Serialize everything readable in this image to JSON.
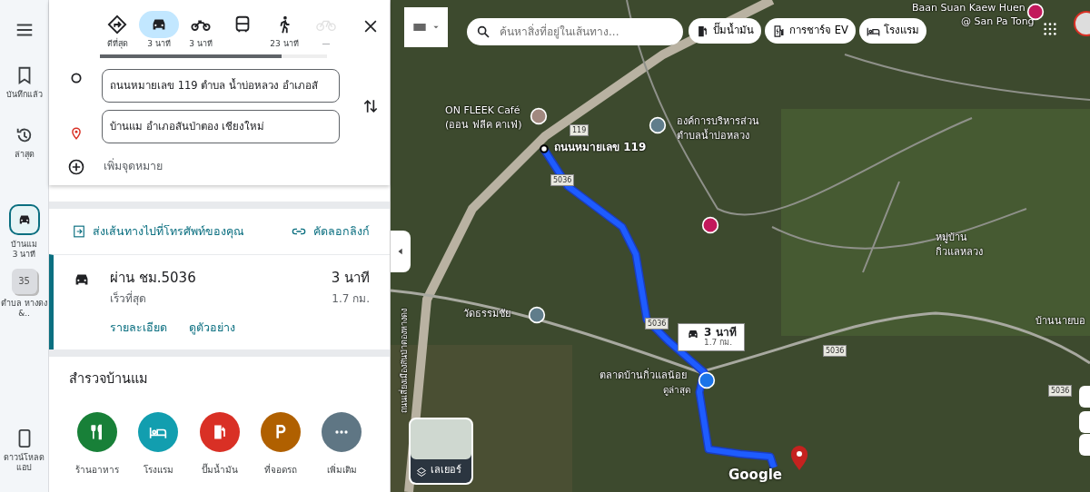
{
  "rail": [
    {
      "kind": "menu"
    },
    {
      "kind": "saved",
      "label": "บันทึกแล้ว"
    },
    {
      "kind": "recent",
      "label": "ล่าสุด"
    },
    {
      "kind": "trip",
      "label": "บ้านแม",
      "sub": "3 นาที",
      "selected": true
    },
    {
      "kind": "place",
      "badge": "35",
      "label": "ตำบล หางดง &..",
      "selected": false
    },
    {
      "kind": "download",
      "label": "ดาวน์โหลด แอป"
    }
  ],
  "modes": [
    {
      "kind": "best",
      "label": "ดีที่สุด",
      "selected": false,
      "disabled": false
    },
    {
      "kind": "car",
      "label": "3 นาที",
      "selected": true,
      "disabled": false
    },
    {
      "kind": "moto",
      "label": "3 นาที",
      "selected": false,
      "disabled": false
    },
    {
      "kind": "transit",
      "selected": false,
      "disabled": false
    },
    {
      "kind": "walk",
      "label": "23 นาที",
      "selected": false,
      "disabled": false
    },
    {
      "kind": "bike",
      "label": "—",
      "selected": false,
      "disabled": true
    }
  ],
  "origin": "ถนนหมายเลข 119 ตำบล น้ำบ่อหลวง อำเภอสั",
  "destination": "บ้านแม อำเภอสันป่าตอง เชียงใหม่",
  "add_destination": "เพิ่มจุดหมาย",
  "send_to_phone": "ส่งเส้นทางไปที่โทรศัพท์ของคุณ",
  "copy_link": "คัดลอกลิงก์",
  "route": {
    "via": "ผ่าน ชม.5036",
    "note": "เร็วที่สุด",
    "time": "3 นาที",
    "distance": "1.7 กม.",
    "links": [
      "รายละเอียด",
      "ดูตัวอย่าง"
    ]
  },
  "explore": {
    "title": "สำรวจบ้านแม",
    "categories": [
      {
        "kind": "food",
        "label": "ร้านอาหาร",
        "color": "#188038"
      },
      {
        "kind": "hotel",
        "label": "โรงแรม",
        "color": "#129eaf"
      },
      {
        "kind": "fuel",
        "label": "ปั๊มน้ำมัน",
        "color": "#d93025"
      },
      {
        "kind": "parking",
        "label": "ที่จอดรถ",
        "color": "#b06000"
      },
      {
        "kind": "more",
        "label": "เพิ่มเติม",
        "color": "#5f7684"
      }
    ]
  },
  "map": {
    "search_placeholder": "ค้นหาสิ่งที่อยู่ในเส้นทาง...",
    "chips": [
      {
        "kind": "fuel",
        "label": "ปั๊มน้ำมัน"
      },
      {
        "kind": "ev",
        "label": "การชาร์จ EV"
      },
      {
        "kind": "hotel",
        "label": "โรงแรม"
      }
    ],
    "labels": [
      {
        "kind": "poi",
        "text": "Baan Suan Kaew Huen"
      },
      {
        "kind": "poi",
        "text": "@ San Pa Tong"
      },
      {
        "kind": "poi",
        "text": "ON FLEEK Café"
      },
      {
        "kind": "poi",
        "text": "(ออน ฟลีค คาเฟ่)"
      },
      {
        "kind": "poi",
        "text": "องค์การบริหารส่วน"
      },
      {
        "kind": "poi",
        "text": "ตำบลน้ำบ่อหลวง"
      },
      {
        "kind": "start",
        "text": "ถนนหมายเลข 119"
      },
      {
        "kind": "shield",
        "text": "119"
      },
      {
        "kind": "shield",
        "text": "5036"
      },
      {
        "kind": "shield",
        "text": "5036"
      },
      {
        "kind": "shield",
        "text": "5036"
      },
      {
        "kind": "shield",
        "text": "5036"
      },
      {
        "kind": "area",
        "text": "หมู่บ้าน"
      },
      {
        "kind": "area",
        "text": "กิ่วแลหลวง"
      },
      {
        "kind": "poi",
        "text": "วัดธรรมชัย"
      },
      {
        "kind": "poi",
        "text": "ตลาดบ้านกิ่วแลน้อย"
      },
      {
        "kind": "sub",
        "text": "ดูล่าสุด"
      },
      {
        "kind": "area",
        "text": "บ้านนายบอ"
      },
      {
        "kind": "road",
        "text": "ถนนเลี่ยงเมืองสันป่าตองหางดง"
      }
    ],
    "callout": {
      "time": "3 นาที",
      "distance": "1.7 กม."
    },
    "layers_label": "เลเยอร์",
    "logo": "Google"
  }
}
